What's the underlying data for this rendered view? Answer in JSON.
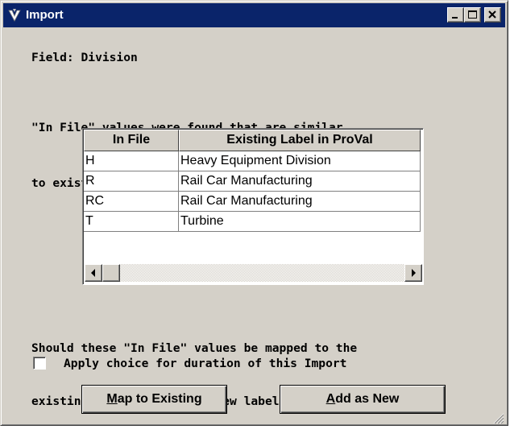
{
  "window": {
    "title": "Import",
    "controls": {
      "minimize_icon": "minimize-icon",
      "maximize_icon": "maximize-icon",
      "close_icon": "close-icon"
    }
  },
  "field_label": "Field: Division",
  "message_lines": [
    "\"In File\" values were found that are similar",
    "to existing labels:"
  ],
  "grid": {
    "columns": [
      "In File",
      "Existing Label in ProVal"
    ],
    "rows": [
      [
        "H",
        "Heavy Equipment Division"
      ],
      [
        "R",
        "Rail Car Manufacturing"
      ],
      [
        "RC",
        "Rail Car Manufacturing"
      ],
      [
        "T",
        "Turbine"
      ]
    ]
  },
  "question_lines": [
    "Should these \"In File\" values be mapped to the",
    "existing labels or should new labels be added?"
  ],
  "checkbox": {
    "label": "Apply choice for duration of this Import",
    "checked": false
  },
  "buttons": {
    "map_first": "M",
    "map_rest": "ap to Existing",
    "add_first": "A",
    "add_rest": "dd as New"
  },
  "colors": {
    "titlebar": "#0a246a",
    "face": "#d4d0c8"
  }
}
